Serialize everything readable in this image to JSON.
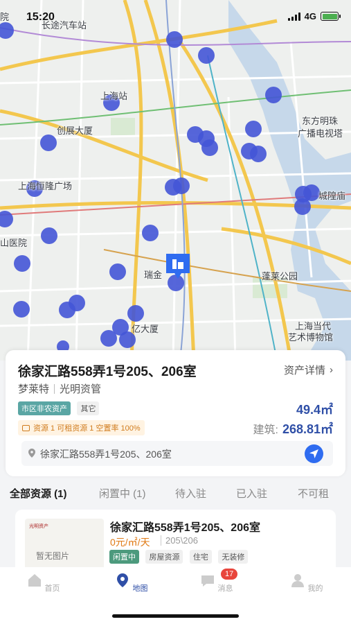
{
  "status_bar": {
    "time": "15:20",
    "network": "4G"
  },
  "map": {
    "labels": [
      "长途汽车站",
      "上海站",
      "创展大厦",
      "上海恒隆广场",
      "山医院",
      "瑞金",
      "亿大厦",
      "蓬莱公园",
      "东方明珠",
      "广播电视塔",
      "城隍庙",
      "上海当代",
      "艺术博物馆",
      "院"
    ]
  },
  "info_card": {
    "title": "徐家汇路558弄1号205、206室",
    "detail_link": "资产详情",
    "owner": "梦莱特",
    "manager": "光明资管",
    "tags": [
      "市区非农资产",
      "其它"
    ],
    "land_area": "49.4㎡",
    "resource_summary": "资源 1 可租资源 1 空置率 100%",
    "building_label": "建筑:",
    "building_area": "268.81㎡",
    "address": "徐家汇路558弄1号205、206室"
  },
  "tabs": [
    {
      "label": "全部资源 (1)",
      "active": true
    },
    {
      "label": "闲置中 (1)",
      "active": false
    },
    {
      "label": "待入驻",
      "active": false
    },
    {
      "label": "已入驻",
      "active": false
    },
    {
      "label": "不可租",
      "active": false
    }
  ],
  "list_item": {
    "title": "徐家汇路558弄1号205、206室",
    "price": "0元/㎡/天",
    "room": "205\\206",
    "thumb_text": "暂无图片",
    "thumb_logo": "光明资产",
    "tags": [
      "闲置中",
      "房屋资源",
      "住宅",
      "无装修"
    ]
  },
  "bottom_nav": [
    {
      "label": "首页",
      "icon": "home-icon",
      "active": false
    },
    {
      "label": "地图",
      "icon": "map-pin-icon",
      "active": true
    },
    {
      "label": "消息",
      "icon": "message-icon",
      "active": false,
      "badge": "17"
    },
    {
      "label": "我的",
      "icon": "profile-icon",
      "active": false
    }
  ],
  "colors": {
    "accent": "#2f4fa7",
    "marker": "#4455d6",
    "price": "#e07a14",
    "tag_teal": "#5aa6a4",
    "tag_green": "#4c9a7d",
    "badge": "#e8453c"
  }
}
